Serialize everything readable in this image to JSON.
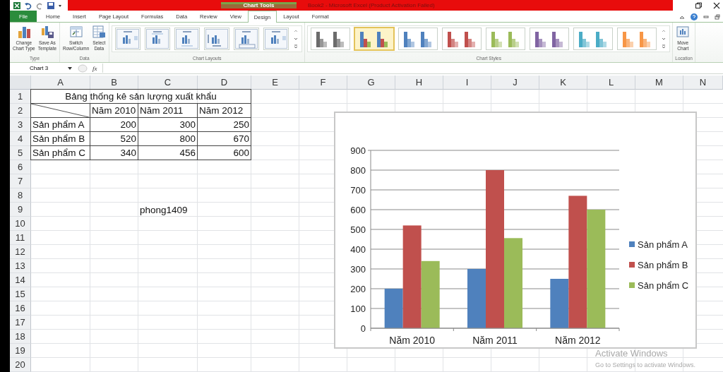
{
  "window": {
    "title": "Book2 - Microsoft Excel (Product Activation Failed)",
    "context_group": "Chart Tools"
  },
  "ribbon_tabs": [
    {
      "label": "File",
      "kind": "file",
      "selected": false
    },
    {
      "label": "Home",
      "kind": "normal",
      "selected": false
    },
    {
      "label": "Insert",
      "kind": "normal",
      "selected": false
    },
    {
      "label": "Page Layout",
      "kind": "normal",
      "selected": false
    },
    {
      "label": "Formulas",
      "kind": "normal",
      "selected": false
    },
    {
      "label": "Data",
      "kind": "normal",
      "selected": false
    },
    {
      "label": "Review",
      "kind": "normal",
      "selected": false
    },
    {
      "label": "View",
      "kind": "normal",
      "selected": false
    },
    {
      "label": "Design",
      "kind": "context",
      "selected": true
    },
    {
      "label": "Layout",
      "kind": "context",
      "selected": false
    },
    {
      "label": "Format",
      "kind": "context",
      "selected": false
    }
  ],
  "ribbon_groups": [
    {
      "label": "Type",
      "buttons": [
        {
          "lines": [
            "Change",
            "Chart Type"
          ],
          "kind": "change_type"
        },
        {
          "lines": [
            "Save As",
            "Template"
          ],
          "kind": "save_template"
        }
      ]
    },
    {
      "label": "Data",
      "buttons": [
        {
          "lines": [
            "Switch",
            "Row/Column"
          ],
          "kind": "switch"
        },
        {
          "lines": [
            "Select",
            "Data"
          ],
          "kind": "select_data"
        }
      ]
    },
    {
      "label": "Chart Layouts",
      "kind": "layouts"
    },
    {
      "label": "Chart Styles",
      "kind": "styles"
    },
    {
      "label": "Location",
      "buttons": [
        {
          "lines": [
            "Move",
            "Chart"
          ],
          "kind": "move"
        }
      ]
    }
  ],
  "chart_layouts": [
    {
      "kind": "legend_right"
    },
    {
      "kind": "legend_top"
    },
    {
      "kind": "legend_bottom"
    },
    {
      "kind": "axis_titles"
    },
    {
      "kind": "data_table"
    },
    {
      "kind": "legend_right"
    }
  ],
  "chart_styles": [
    {
      "kind": "mono",
      "color": "#6b6b6b",
      "selected": false
    },
    {
      "kind": "multi",
      "color": "#4f81bd",
      "selected": true
    },
    {
      "kind": "mono",
      "color": "#4f81bd",
      "selected": false
    },
    {
      "kind": "mono",
      "color": "#c0504d",
      "selected": false
    },
    {
      "kind": "mono",
      "color": "#9bbb59",
      "selected": false
    },
    {
      "kind": "mono",
      "color": "#8064a2",
      "selected": false
    },
    {
      "kind": "mono",
      "color": "#4bacc6",
      "selected": false
    },
    {
      "kind": "mono",
      "color": "#f79646",
      "selected": false
    }
  ],
  "formula_bar": {
    "name_box": "Chart 3",
    "function_label": "fx"
  },
  "sheet": {
    "columns": [
      "A",
      "B",
      "C",
      "D",
      "E",
      "F",
      "G",
      "H",
      "I",
      "J",
      "K",
      "L",
      "M",
      "N"
    ],
    "rows": [
      {
        "header": "1",
        "cells": [
          {
            "kind": "title",
            "text": "Bảng thống kê sản lượng xuất khẩu"
          }
        ]
      },
      {
        "header": "2",
        "cells": [
          {
            "kind": "diagonal"
          },
          {
            "kind": "text",
            "text": "Năm 2010"
          },
          {
            "kind": "text",
            "text": "Năm 2011"
          },
          {
            "kind": "text",
            "text": "Năm 2012"
          }
        ]
      },
      {
        "header": "3",
        "cells": [
          {
            "kind": "text",
            "text": "Sản phẩm A"
          },
          {
            "kind": "number",
            "text": "200"
          },
          {
            "kind": "number",
            "text": "300"
          },
          {
            "kind": "number",
            "text": "250"
          }
        ]
      },
      {
        "header": "4",
        "cells": [
          {
            "kind": "text",
            "text": "Sản phẩm B"
          },
          {
            "kind": "number",
            "text": "520"
          },
          {
            "kind": "number",
            "text": "800"
          },
          {
            "kind": "number",
            "text": "670"
          }
        ]
      },
      {
        "header": "5",
        "cells": [
          {
            "kind": "text",
            "text": "Sản phẩm C"
          },
          {
            "kind": "number",
            "text": "340"
          },
          {
            "kind": "number",
            "text": "456"
          },
          {
            "kind": "number",
            "text": "600"
          }
        ]
      },
      {
        "header": "6",
        "cells": []
      },
      {
        "header": "7",
        "cells": []
      },
      {
        "header": "8",
        "cells": []
      },
      {
        "header": "9",
        "cells": [
          {
            "kind": "empty"
          },
          {
            "kind": "empty"
          },
          {
            "kind": "plain",
            "text": "phong1409"
          }
        ]
      },
      {
        "header": "10",
        "cells": []
      },
      {
        "header": "11",
        "cells": []
      },
      {
        "header": "12",
        "cells": []
      },
      {
        "header": "13",
        "cells": []
      },
      {
        "header": "14",
        "cells": []
      },
      {
        "header": "15",
        "cells": []
      },
      {
        "header": "16",
        "cells": []
      },
      {
        "header": "17",
        "cells": []
      },
      {
        "header": "18",
        "cells": []
      },
      {
        "header": "19",
        "cells": []
      },
      {
        "header": "20",
        "cells": []
      }
    ]
  },
  "chart": {
    "chart_data": {
      "type": "bar",
      "categories": [
        "Năm 2010",
        "Năm 2011",
        "Năm 2012"
      ],
      "series": [
        {
          "name": "Sản phẩm A",
          "color": "#4f81bd",
          "values": [
            200,
            300,
            250
          ]
        },
        {
          "name": "Sản phẩm B",
          "color": "#c0504d",
          "values": [
            520,
            800,
            670
          ]
        },
        {
          "name": "Sản phẩm C",
          "color": "#9bbb59",
          "values": [
            340,
            456,
            600
          ]
        }
      ],
      "ylim": [
        0,
        900
      ],
      "grid": true,
      "legend": true,
      "yticks": [
        {
          "value": 0,
          "label": "0"
        },
        {
          "value": 100,
          "label": "100"
        },
        {
          "value": 200,
          "label": "200"
        },
        {
          "value": 300,
          "label": "300"
        },
        {
          "value": 400,
          "label": "400"
        },
        {
          "value": 500,
          "label": "500"
        },
        {
          "value": 600,
          "label": "600"
        },
        {
          "value": 700,
          "label": "700"
        },
        {
          "value": 800,
          "label": "800"
        },
        {
          "value": 900,
          "label": "900"
        }
      ]
    }
  },
  "os_notice": {
    "title": "Activate Windows",
    "subtitle": "Go to Settings to activate Windows."
  }
}
